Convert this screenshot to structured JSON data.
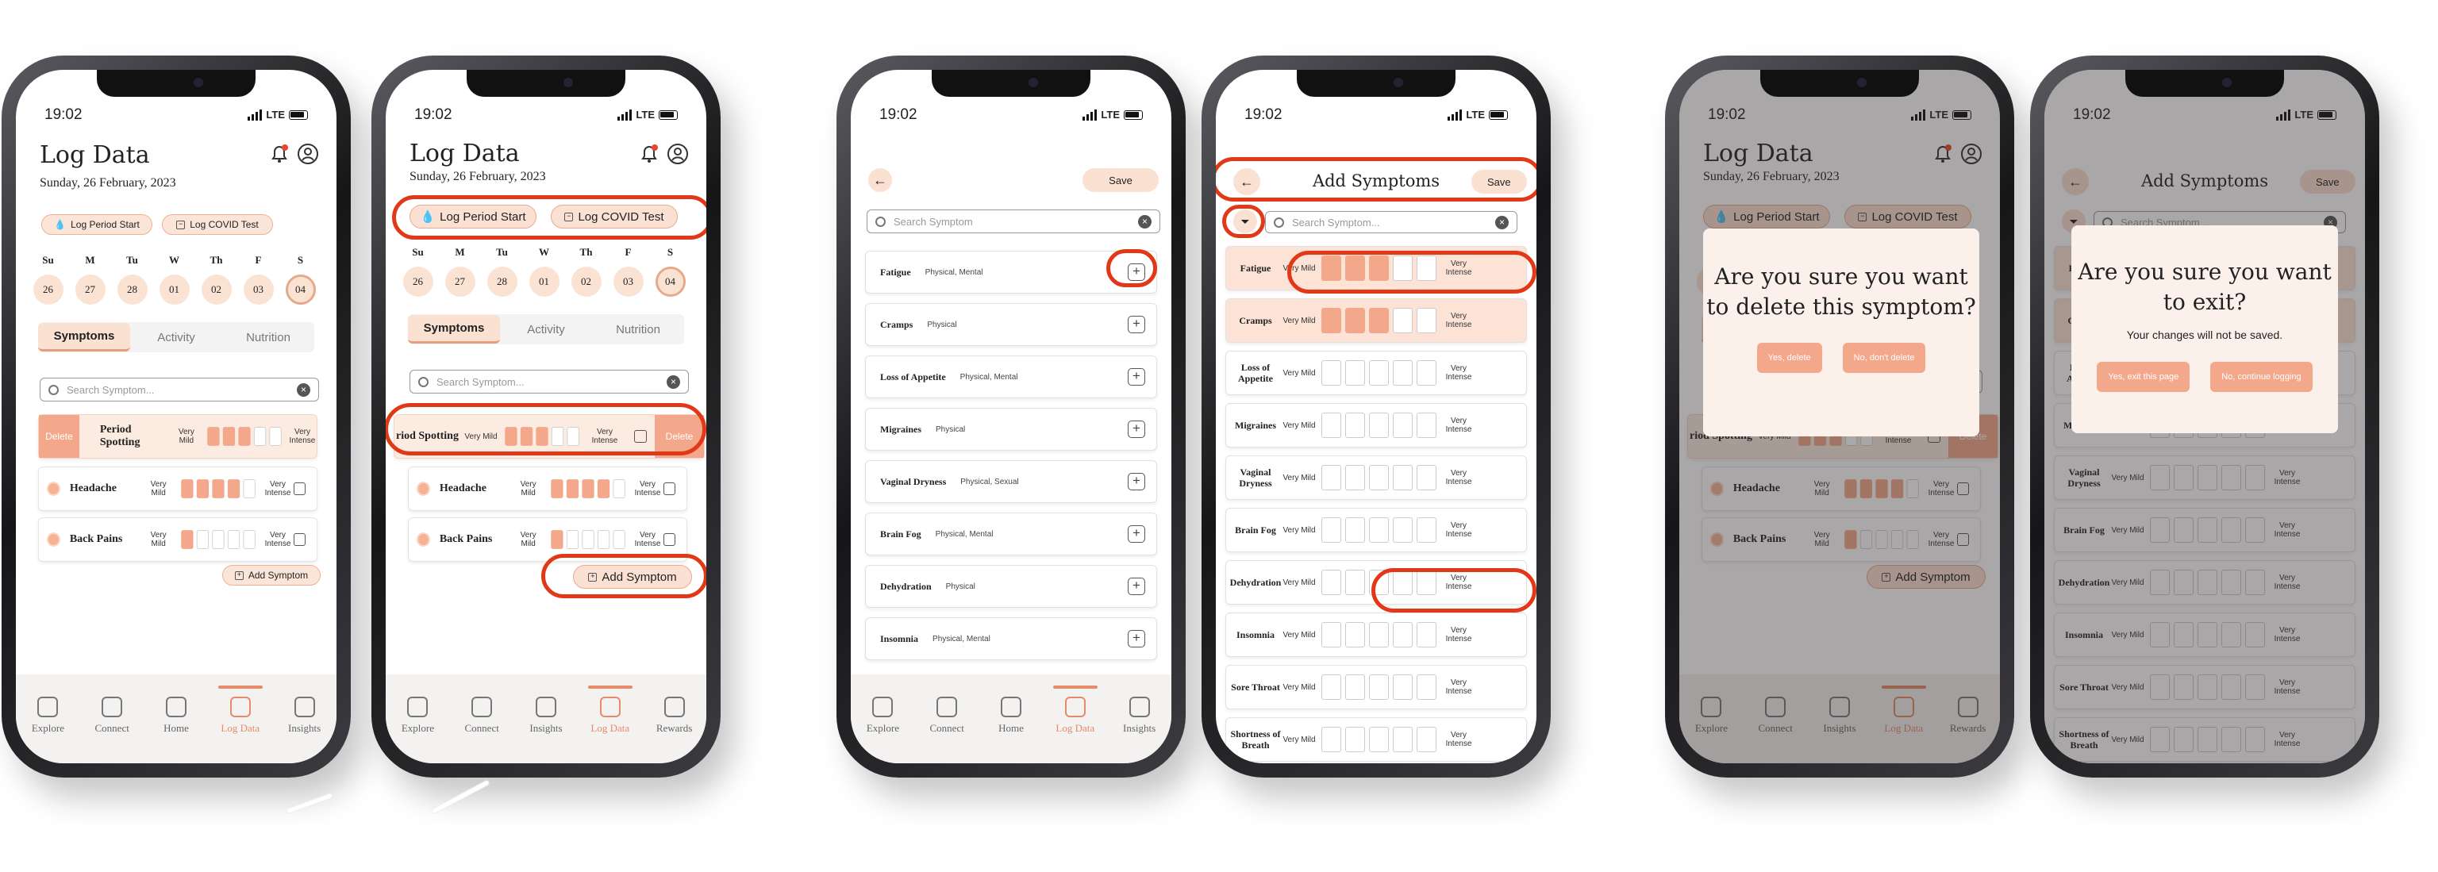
{
  "status": {
    "time": "19:02",
    "network": "LTE"
  },
  "log": {
    "title": "Log Data",
    "date": "Sunday, 26 February, 2023",
    "period_btn": "Log Period Start",
    "covid_btn": "Log COVID Test",
    "days": [
      {
        "dow": "Su",
        "num": "26"
      },
      {
        "dow": "M",
        "num": "27"
      },
      {
        "dow": "Tu",
        "num": "28"
      },
      {
        "dow": "W",
        "num": "01"
      },
      {
        "dow": "Th",
        "num": "02"
      },
      {
        "dow": "F",
        "num": "03"
      },
      {
        "dow": "S",
        "num": "04"
      }
    ],
    "selected_day": "04",
    "tabs": [
      "Symptoms",
      "Activity",
      "Nutrition"
    ],
    "search_placeholder": "Search Symptom...",
    "delete_label": "Delete",
    "scale_low": "Very Mild",
    "scale_high": "Very Intense",
    "logged": [
      {
        "name": "Period Spotting",
        "partial_name": "riod Spotting",
        "level": 3
      },
      {
        "name": "Headache",
        "level": 4
      },
      {
        "name": "Back Pains",
        "level": 1
      }
    ],
    "add_symptom": "Add Symptom"
  },
  "nav": {
    "items_a": [
      "Explore",
      "Connect",
      "Home",
      "Log Data",
      "Insights"
    ],
    "items_b": [
      "Explore",
      "Connect",
      "Insights",
      "Log Data",
      "Rewards"
    ]
  },
  "list": {
    "save": "Save",
    "search_placeholder": "Search Symptom",
    "items": [
      {
        "name": "Fatigue",
        "cat": "Physical, Mental"
      },
      {
        "name": "Cramps",
        "cat": "Physical"
      },
      {
        "name": "Loss of Appetite",
        "cat": "Physical, Mental"
      },
      {
        "name": "Migraines",
        "cat": "Physical"
      },
      {
        "name": "Vaginal Dryness",
        "cat": "Physical, Sexual"
      },
      {
        "name": "Brain Fog",
        "cat": "Physical, Mental"
      },
      {
        "name": "Dehydration",
        "cat": "Physical"
      },
      {
        "name": "Insomnia",
        "cat": "Physical, Mental"
      }
    ]
  },
  "add": {
    "title": "Add Symptoms",
    "save": "Save",
    "search_placeholder": "Search Symptom...",
    "items": [
      {
        "name": "Fatigue",
        "level": 3
      },
      {
        "name": "Cramps",
        "level": 3
      },
      {
        "name": "Loss of Appetite",
        "level": 0
      },
      {
        "name": "Migraines",
        "level": 0
      },
      {
        "name": "Vaginal Dryness",
        "level": 0
      },
      {
        "name": "Brain Fog",
        "level": 0
      },
      {
        "name": "Dehydration",
        "level": 0
      },
      {
        "name": "Insomnia",
        "level": 0
      },
      {
        "name": "Sore Throat",
        "level": 0
      },
      {
        "name": "Shortness of Breath",
        "level": 0
      }
    ]
  },
  "modal_delete": {
    "text": "Are you sure you want to delete this symptom?",
    "yes": "Yes, delete",
    "no": "No, don't delete"
  },
  "modal_exit": {
    "text": "Are you sure you want to exit?",
    "sub": "Your changes will not be saved.",
    "yes": "Yes, exit this page",
    "no": "No, continue logging"
  },
  "colors": {
    "accent": "#f3a88b",
    "highlight": "#e13917",
    "tint": "#fbe1d2"
  }
}
